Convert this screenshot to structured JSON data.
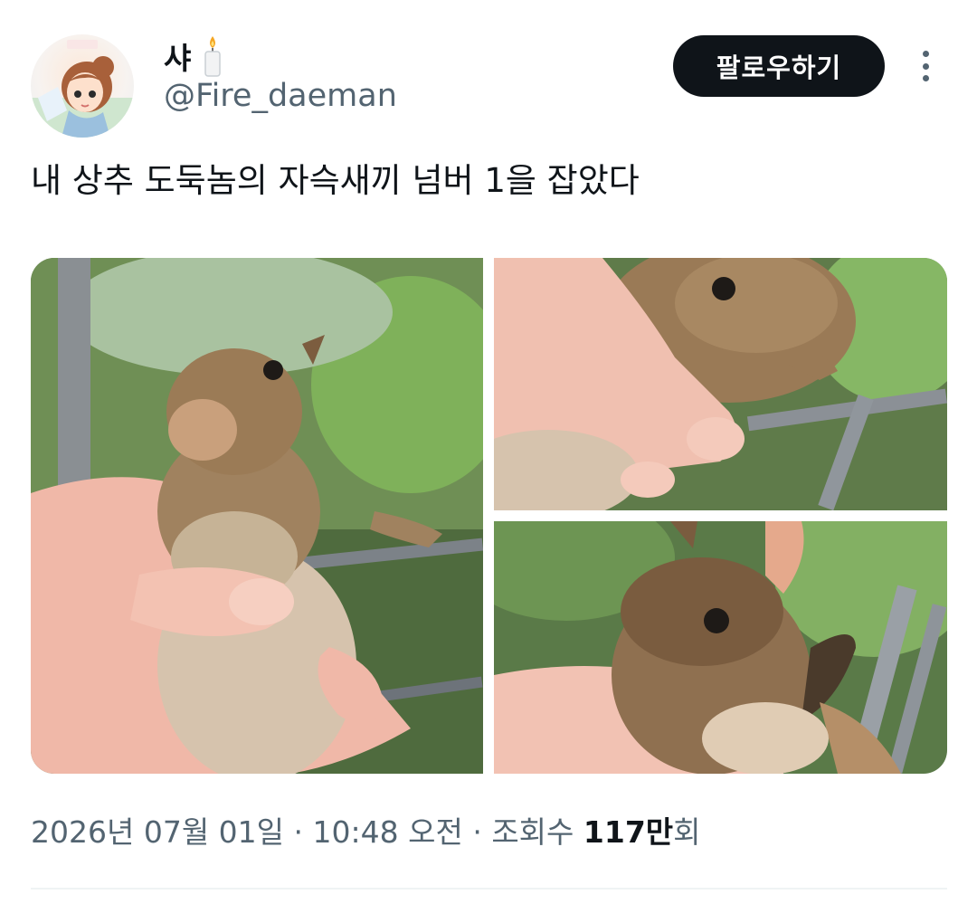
{
  "author": {
    "display_name": "샤",
    "badge_icon": "candle-icon",
    "handle": "@Fire_daeman"
  },
  "actions": {
    "follow_label": "팔로우하기",
    "more_icon": "more-vertical-icon"
  },
  "tweet": {
    "text": "내 상추 도둑놈의 자슥새끼 넘버 1을 잡았다"
  },
  "media": [
    {
      "alt": "hand holding baby rabbit, front view"
    },
    {
      "alt": "hand holding baby rabbit, side view"
    },
    {
      "alt": "baby rabbit close-up on hand"
    }
  ],
  "meta": {
    "date": "2026년 07월 01일",
    "separator": " · ",
    "time": "10:48 오전",
    "views_label": "조회수 ",
    "views_number": "117만",
    "views_suffix": "회"
  },
  "colors": {
    "text_primary": "#0f1419",
    "text_secondary": "#536471",
    "button_bg": "#0f1419",
    "divider": "#eff3f4"
  }
}
